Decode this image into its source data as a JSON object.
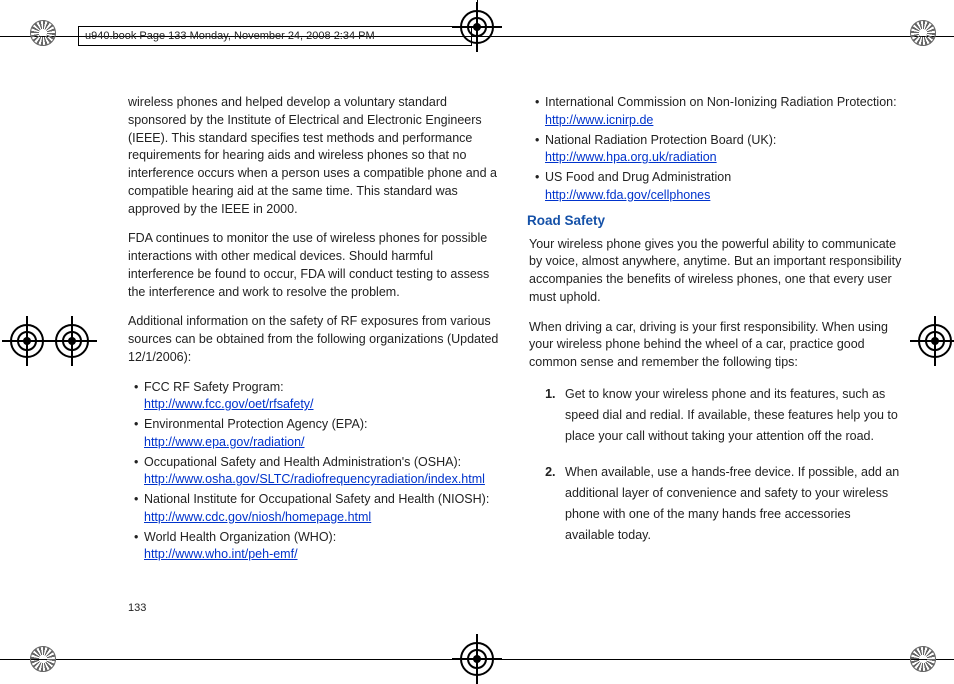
{
  "meta_bar": "u940.book  Page 133  Monday, November 24, 2008  2:34 PM",
  "page_num": "133",
  "col1": {
    "p1": "wireless phones and helped develop a voluntary standard sponsored by the Institute of Electrical and Electronic Engineers (IEEE). This standard specifies test methods and performance requirements for hearing aids and wireless phones so that no interference occurs when a person uses a compatible phone and a compatible hearing aid at the same time. This standard was approved by the IEEE in 2000.",
    "p2": "FDA continues to monitor the use of wireless phones for possible interactions with other medical devices. Should harmful interference be found to occur, FDA will conduct testing to assess the interference and work to resolve the problem.",
    "p3": "Additional information on the safety of RF exposures from various sources can be obtained from the following organizations (Updated 12/1/2006):",
    "items": [
      {
        "label": "FCC RF Safety Program:",
        "url": "http://www.fcc.gov/oet/rfsafety/"
      },
      {
        "label": "Environmental Protection Agency (EPA):",
        "url": "http://www.epa.gov/radiation/"
      },
      {
        "label": "Occupational Safety and Health Administration's (OSHA):",
        "url": "http://www.osha.gov/SLTC/radiofrequencyradiation/index.html"
      },
      {
        "label": "National Institute for Occupational Safety and Health (NIOSH):",
        "url": "http://www.cdc.gov/niosh/homepage.html"
      },
      {
        "label": "World Health Organization (WHO):",
        "url": "http://www.who.int/peh-emf/"
      }
    ]
  },
  "col2": {
    "items": [
      {
        "label": "International Commission on Non-Ionizing Radiation Protection:",
        "url": "http://www.icnirp.de"
      },
      {
        "label": "National Radiation Protection Board (UK):",
        "url": "http://www.hpa.org.uk/radiation"
      },
      {
        "label": "US Food and Drug Administration",
        "url": "http://www.fda.gov/cellphones"
      }
    ],
    "heading": "Road Safety",
    "p1": "Your wireless phone gives you the powerful ability to communicate by voice, almost anywhere, anytime. But an important responsibility accompanies the benefits of wireless phones, one that every user must uphold.",
    "p2": "When driving a car, driving is your first responsibility. When using your wireless phone behind the wheel of a car, practice good common sense and remember the following tips:",
    "ol": [
      "Get to know your wireless phone and its features, such as speed dial and redial. If available, these features help you to place your call without taking your attention off the road.",
      "When available, use a hands-free device. If possible, add an additional layer of convenience and safety to your wireless phone with one of the many hands free accessories available today."
    ]
  }
}
